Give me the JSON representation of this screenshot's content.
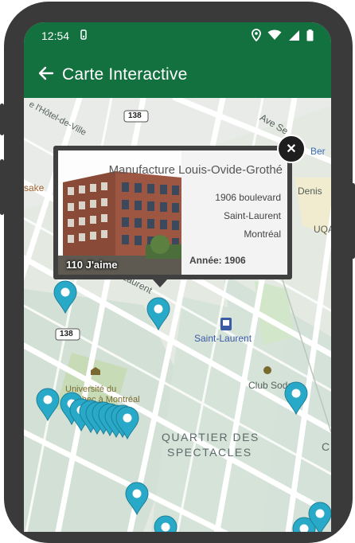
{
  "status_bar": {
    "time": "12:54"
  },
  "app_bar": {
    "title": "Carte Interactive"
  },
  "map": {
    "labels": {
      "hotel_de_ville": "e l'Hôtel-de-Ville",
      "ave_se": "Ave Se",
      "route_138_top": "138",
      "route_138_mid": "138",
      "ber": "Ber",
      "denis": "Denis",
      "uqa": "UQA",
      "sake": "sake",
      "laurent_street": "Laurent",
      "saint_laurent": "Saint-Laurent",
      "universite": "Université du Québec à Montréal",
      "universite_line1": "Université du",
      "universite_line2": "Québec à Montréal",
      "club_soda": "Club Soda",
      "quartier_line1": "QUARTIER DES",
      "quartier_line2": "SPECTACLES",
      "c_edge": "C"
    }
  },
  "popup": {
    "title": "Manufacture Louis-Ovide-Grothé",
    "address_line1": "1906 boulevard",
    "address_line2": "Saint-Laurent",
    "address_line3": "Montréal",
    "year": "Année: 1906",
    "likes": "110 J'aime",
    "close_symbol": "✕"
  },
  "colors": {
    "app_green": "#13703f",
    "marker_teal": "#29a9c8",
    "popup_dark": "#404040"
  }
}
